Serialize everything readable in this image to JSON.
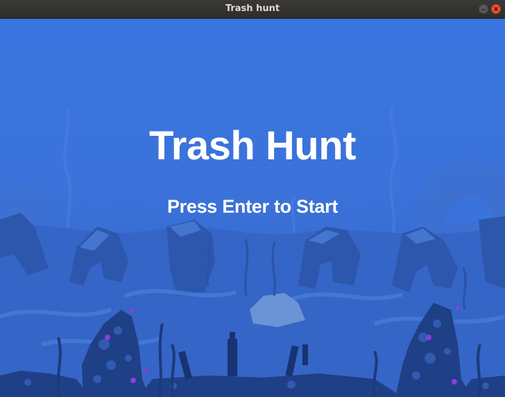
{
  "window": {
    "title": "Trash hunt"
  },
  "game": {
    "title": "Trash Hunt",
    "prompt": "Press Enter to Start"
  },
  "icons": {
    "minimize": "minimize-icon",
    "close": "close-icon"
  },
  "colors": {
    "water": "#3a74de",
    "rock_dark": "#1f3f86",
    "rock_mid": "#2d55a8",
    "rock_light": "#5a86d0",
    "seaweed": "#2a4f9c",
    "coral_purple": "#8a3fd6",
    "text": "#ffffff"
  }
}
